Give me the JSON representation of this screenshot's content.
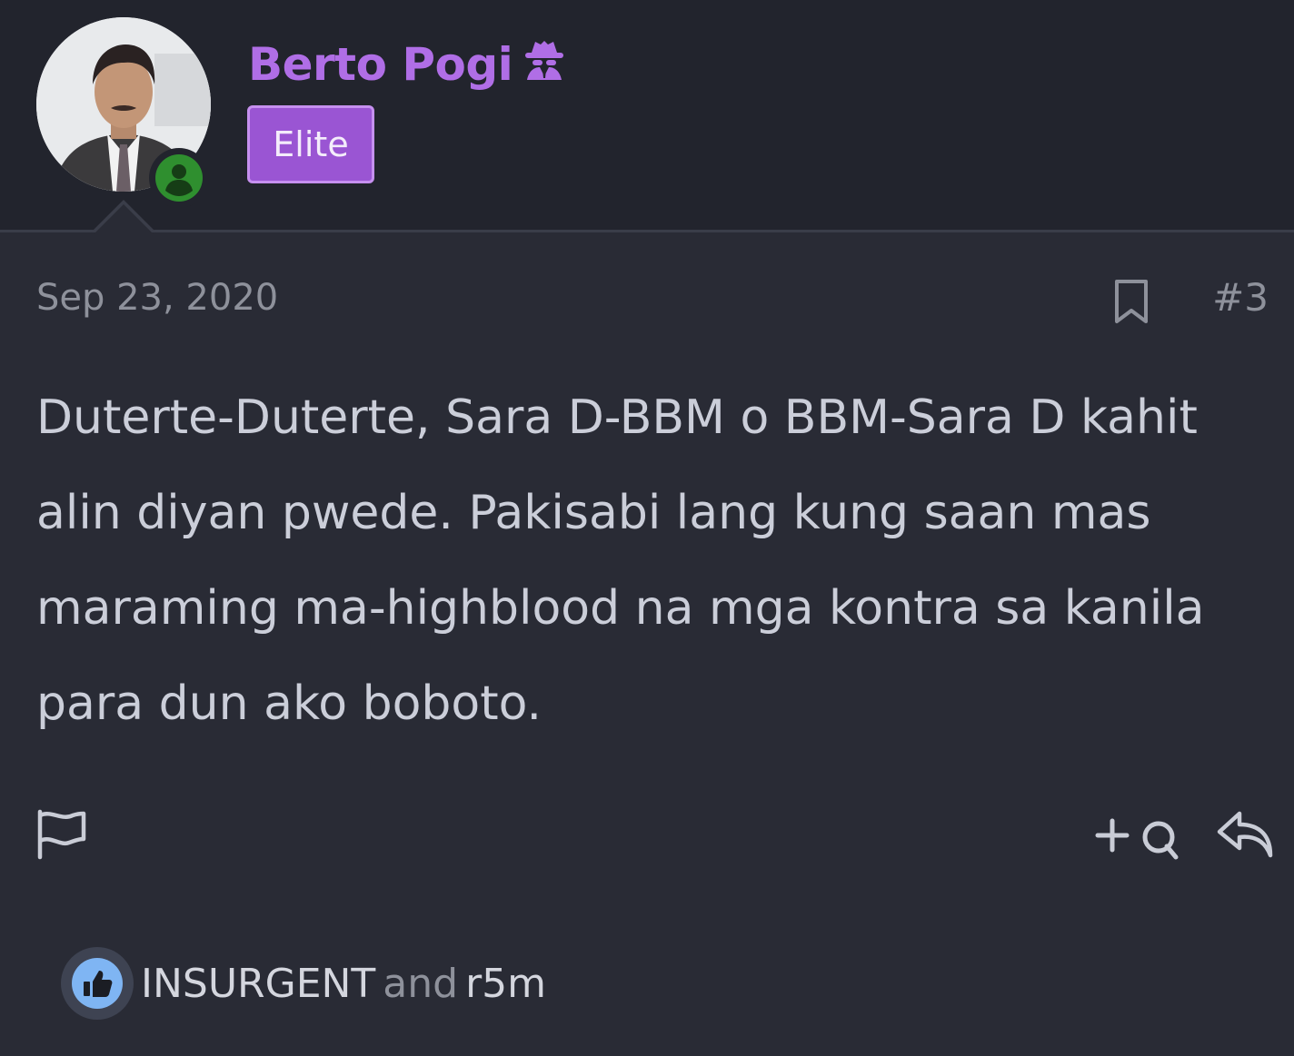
{
  "user": {
    "name": "Berto Pogi",
    "badge": "Elite"
  },
  "post": {
    "date": "Sep 23, 2020",
    "number": "#3",
    "body": "Duterte-Duterte, Sara D-BBM o BBM-Sara D kahit alin diyan pwede. Pakisabi lang kung saan mas maraming ma-highblood na mga kontra sa kanila para dun ako boboto."
  },
  "reactions": {
    "user1": "INSURGENT",
    "joiner": "and",
    "user2": "r5m"
  },
  "colors": {
    "username": "#b06ee6",
    "badge_bg": "#9a55d3",
    "online": "#2f8f2f",
    "like": "#7fb5f3"
  },
  "icons": [
    "spy-icon",
    "online-status-icon",
    "bookmark-icon",
    "report-flag-icon",
    "multi-quote-icon",
    "reply-icon",
    "like-icon"
  ]
}
